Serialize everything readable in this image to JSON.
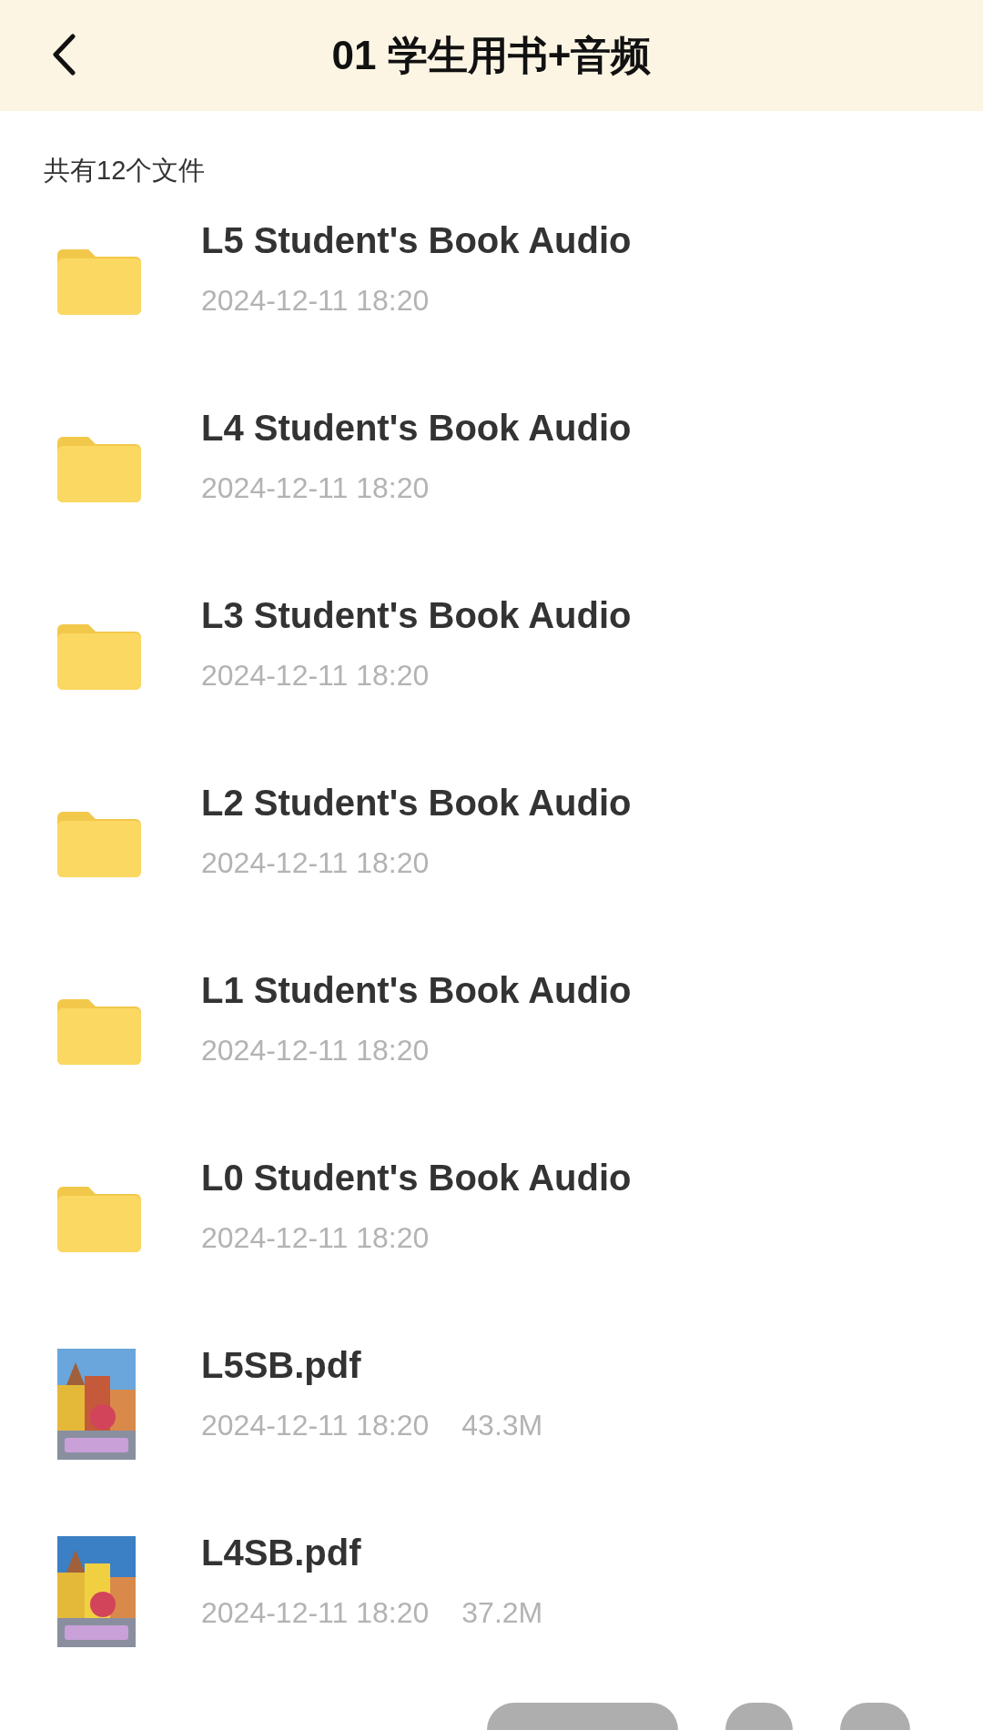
{
  "header": {
    "title": "01 学生用书+音频"
  },
  "summary": "共有12个文件",
  "files": [
    {
      "kind": "folder",
      "name": "L5 Student's Book Audio",
      "date": "2024-12-11 18:20"
    },
    {
      "kind": "folder",
      "name": "L4 Student's Book Audio",
      "date": "2024-12-11 18:20"
    },
    {
      "kind": "folder",
      "name": "L3 Student's Book Audio",
      "date": "2024-12-11 18:20"
    },
    {
      "kind": "folder",
      "name": "L2 Student's Book Audio",
      "date": "2024-12-11 18:20"
    },
    {
      "kind": "folder",
      "name": "L1 Student's Book Audio",
      "date": "2024-12-11 18:20"
    },
    {
      "kind": "folder",
      "name": "L0 Student's Book Audio",
      "date": "2024-12-11 18:20"
    },
    {
      "kind": "pdf",
      "name": "L5SB.pdf",
      "date": "2024-12-11 18:20",
      "size": "43.3M"
    },
    {
      "kind": "pdf",
      "name": "L4SB.pdf",
      "date": "2024-12-11 18:20",
      "size": "37.2M"
    }
  ]
}
